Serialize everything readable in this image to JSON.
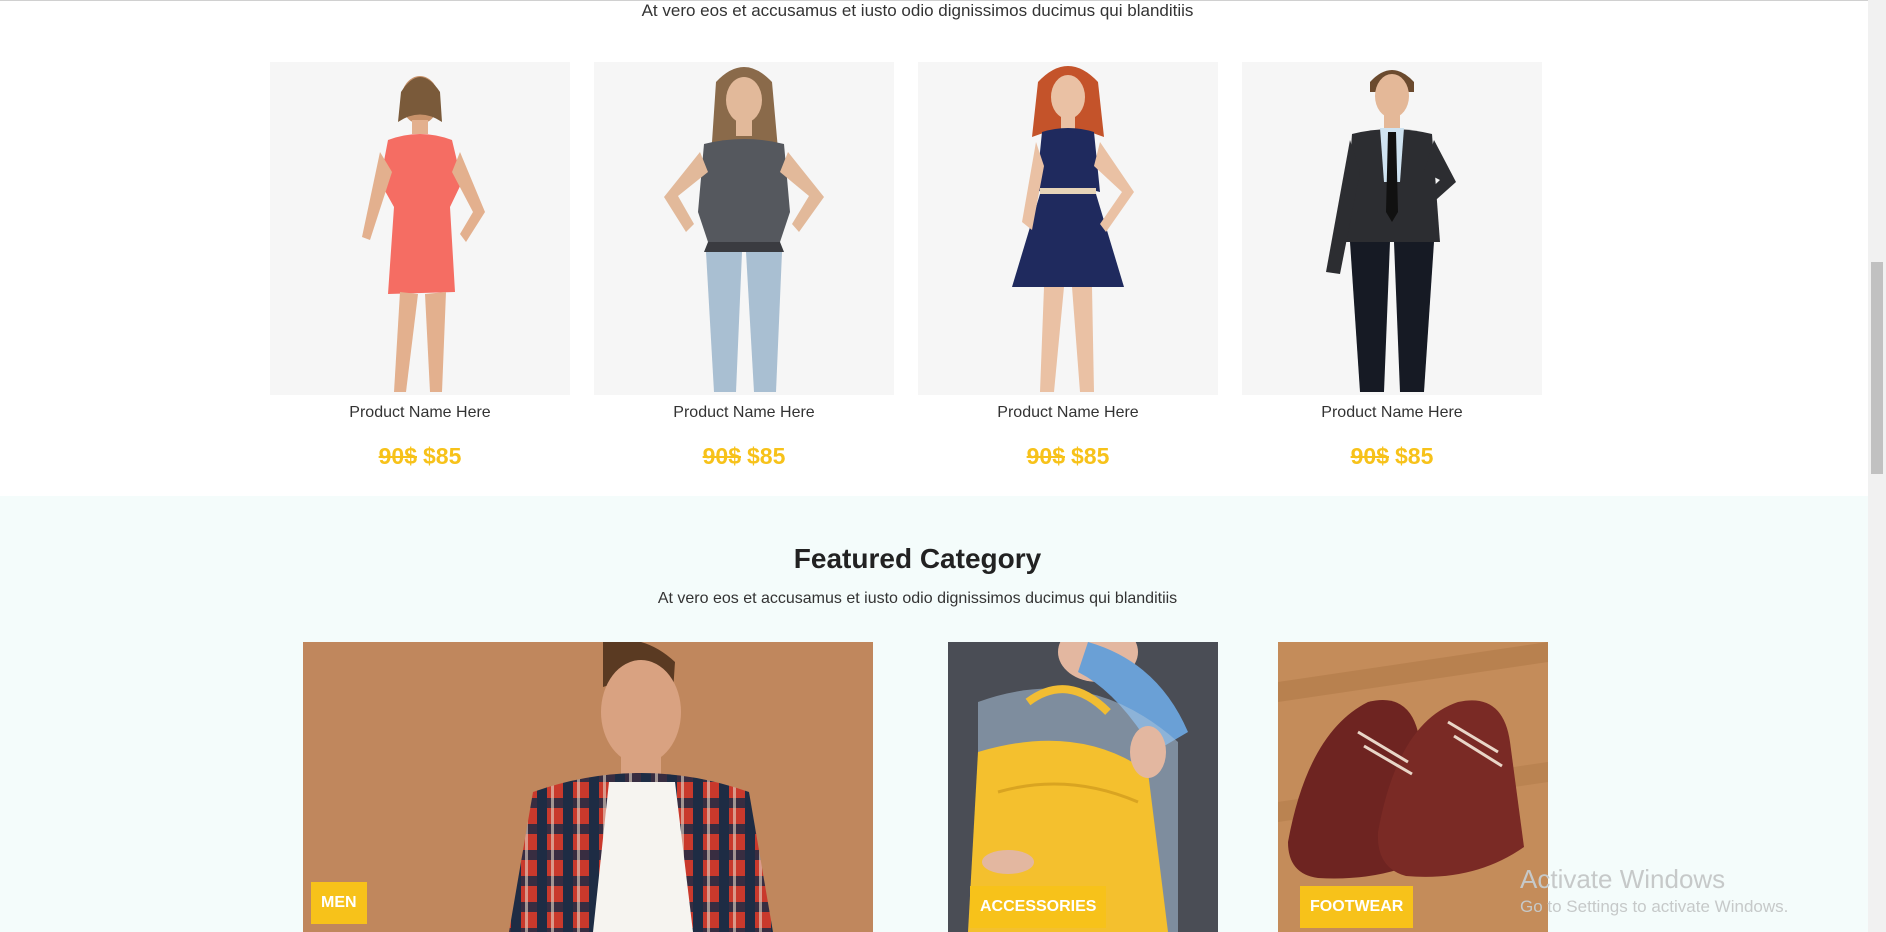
{
  "section_subtitle": "At vero eos et accusamus et iusto odio dignissimos ducimus qui blanditiis",
  "products": [
    {
      "name": "Product Name Here",
      "old_price": "90$",
      "price": "$85",
      "image": "woman-coral-dress"
    },
    {
      "name": "Product Name Here",
      "old_price": "90$",
      "price": "$85",
      "image": "woman-top-jeans"
    },
    {
      "name": "Product Name Here",
      "old_price": "90$",
      "price": "$85",
      "image": "woman-navy-dress"
    },
    {
      "name": "Product Name Here",
      "old_price": "90$",
      "price": "$85",
      "image": "man-black-suit"
    }
  ],
  "featured": {
    "title": "Featured Category",
    "subtitle": "At vero eos et accusamus et iusto odio dignissimos ducimus qui blanditiis",
    "categories": [
      {
        "label": "MEN",
        "image": "man-plaid-shirt"
      },
      {
        "label": "ACCESSORIES",
        "image": "yellow-handbag"
      },
      {
        "label": "FOOTWEAR",
        "image": "brown-leather-shoes"
      }
    ]
  },
  "os_watermark": {
    "line1": "Activate Windows",
    "line2": "Go to Settings to activate Windows."
  },
  "colors": {
    "accent": "#f7c21a",
    "featured_background": "#f4fcfb",
    "product_image_background": "#f6f6f6"
  }
}
